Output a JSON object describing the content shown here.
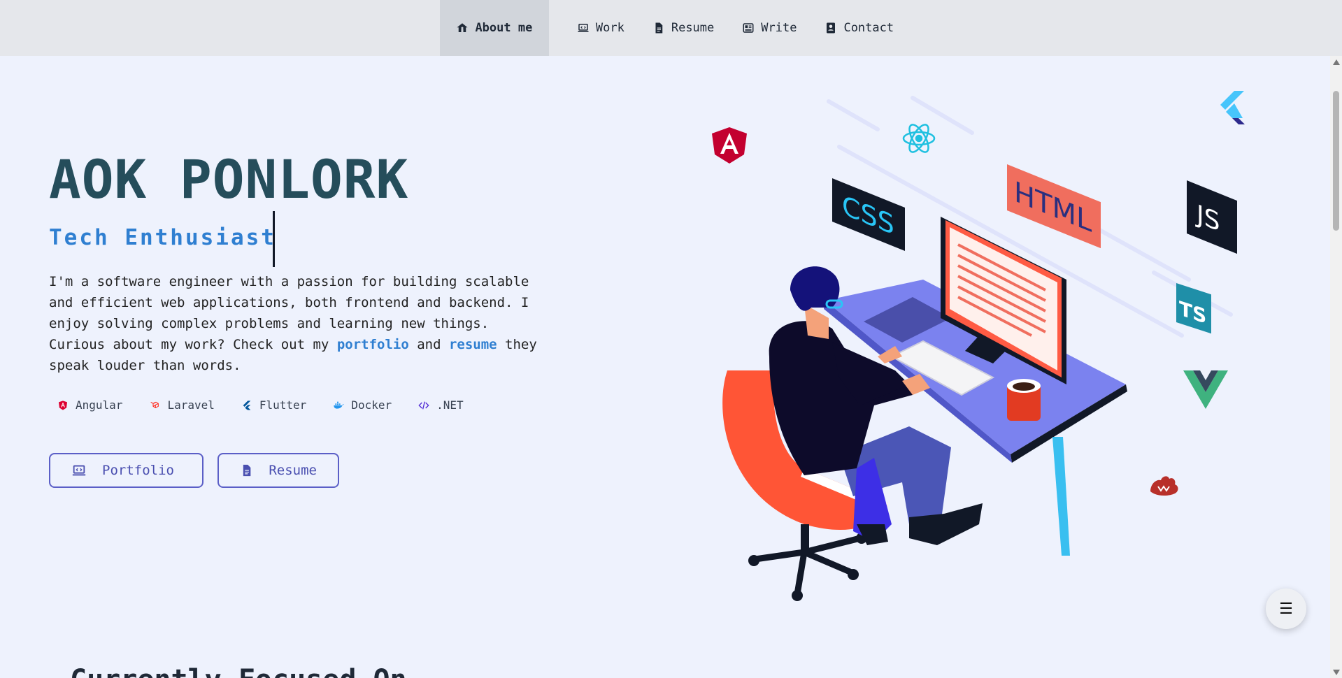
{
  "nav": {
    "items": [
      {
        "label": "About me",
        "icon": "home-icon"
      },
      {
        "label": "Work",
        "icon": "laptop-code-icon"
      },
      {
        "label": "Resume",
        "icon": "file-icon"
      },
      {
        "label": "Write",
        "icon": "newspaper-icon"
      },
      {
        "label": "Contact",
        "icon": "contact-book-icon"
      }
    ],
    "active": "About me"
  },
  "hero": {
    "name": "AOK PONLORK",
    "subtitle": "Tech Enthusiast",
    "bio_before_portfolio": "I'm a software engineer with a passion for building scalable and efficient web applications, both frontend and backend. I enjoy solving complex problems and learning new things. Curious about my work? Check out my ",
    "portfolio_link": "portfolio",
    "bio_between": " and ",
    "resume_link": "resume",
    "bio_after": " they speak louder than words."
  },
  "tech_stack": [
    {
      "label": "Angular",
      "icon": "angular-icon",
      "color": "#dd0031"
    },
    {
      "label": "Laravel",
      "icon": "laravel-icon",
      "color": "#ff2d20"
    },
    {
      "label": "Flutter",
      "icon": "flutter-icon",
      "color": "#02569b"
    },
    {
      "label": "Docker",
      "icon": "docker-icon",
      "color": "#2496ed"
    },
    {
      "label": ".NET",
      "icon": "code-icon",
      "color": "#512bd4"
    }
  ],
  "buttons": {
    "portfolio": "Portfolio",
    "resume": "Resume"
  },
  "next_section_title": "Currently Focused On",
  "illustration_labels": {
    "css": "CSS",
    "html": "HTML",
    "js": "JS",
    "ts": "TS"
  },
  "colors": {
    "accent": "#2f7fd1",
    "name": "#254d5b",
    "button_border": "#5b5fc7",
    "background": "#eef2fd"
  }
}
